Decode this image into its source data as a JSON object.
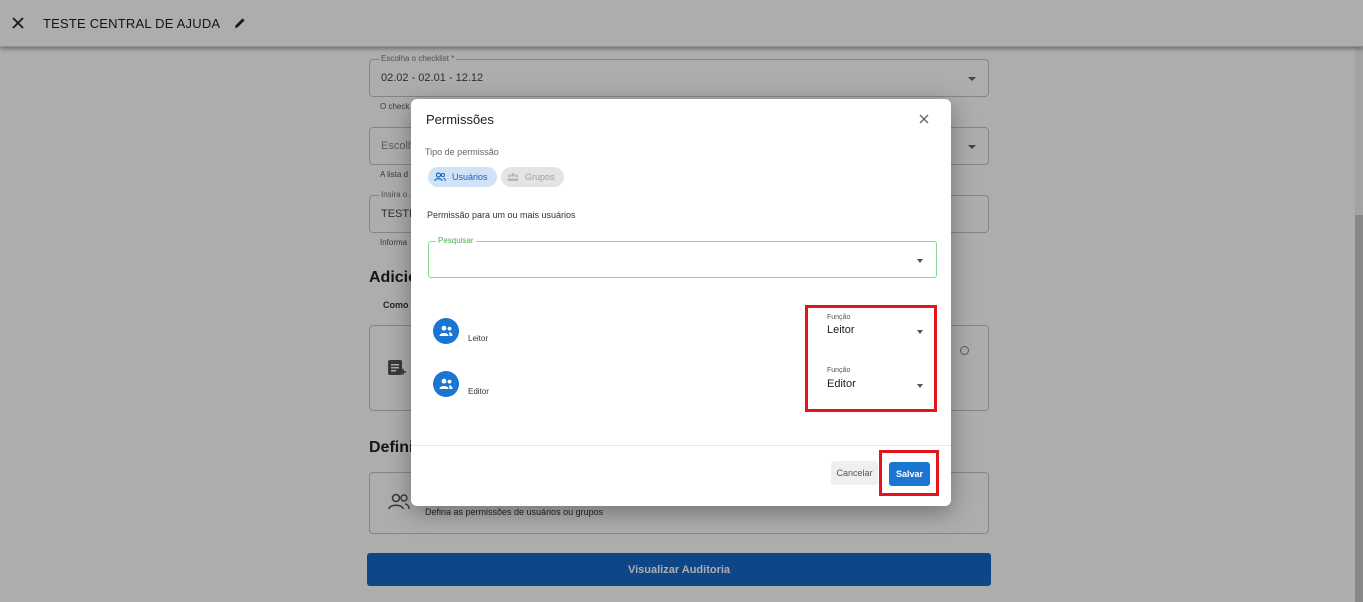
{
  "header": {
    "title": "TESTE CENTRAL DE AJUDA"
  },
  "form": {
    "checklist": {
      "label": "Escolha o checklist *",
      "value": "02.02 - 02.01 - 12.12",
      "helper": "O check"
    },
    "field2": {
      "value": "Escolh",
      "helper": "A lista d"
    },
    "field3": {
      "label": "Insira o",
      "value": "TESTE",
      "helper": "Informa"
    },
    "section_add": {
      "title": "Adicio",
      "subtitle": "Como"
    },
    "section_define": {
      "title": "Defini",
      "card_text": "Defina as permissões de usuários ou grupos"
    },
    "visualize_button": "Visualizar Auditoria"
  },
  "dialog": {
    "title": "Permissões",
    "type_label": "Tipo de permissão",
    "chips": [
      {
        "label": "Usuários",
        "selected": true
      },
      {
        "label": "Grupos",
        "selected": false
      }
    ],
    "description": "Permissão para um ou mais usuários",
    "search_label": "Pesquisar",
    "rows": [
      {
        "name": "Leitor",
        "function_label": "Função",
        "function_value": "Leitor"
      },
      {
        "name": "Editor",
        "function_label": "Função",
        "function_value": "Editor"
      }
    ],
    "cancel_label": "Cancelar",
    "save_label": "Salvar"
  },
  "colors": {
    "accent": "#1976d2",
    "visualize_button": "#1668c7",
    "highlight": "#e4141b",
    "search_border": "#8bd68b"
  }
}
